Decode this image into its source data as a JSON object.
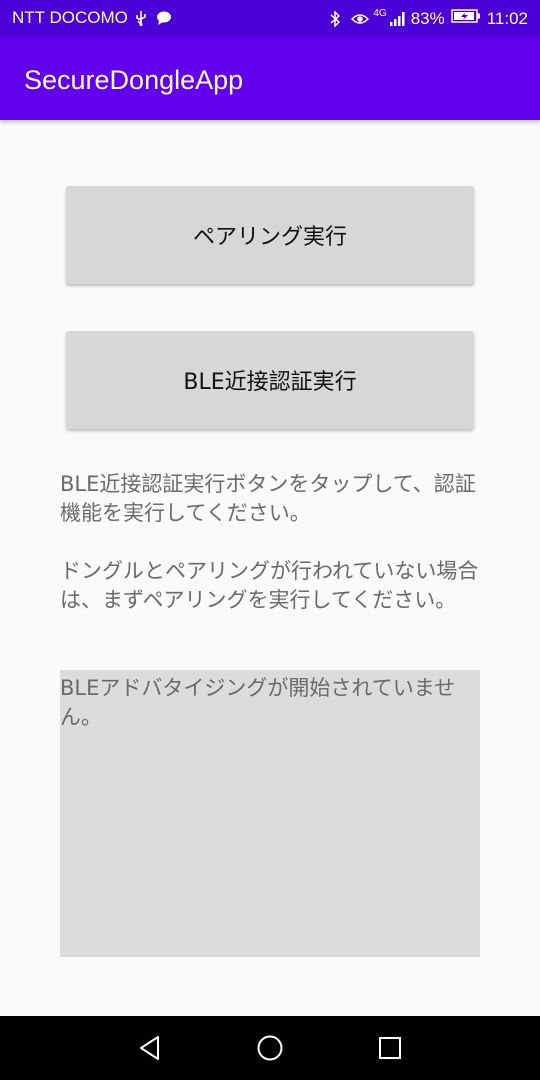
{
  "status_bar": {
    "carrier": "NTT DOCOMO",
    "network": "4G",
    "battery": "83%",
    "time": "11:02",
    "icons": [
      "usb-icon",
      "message-icon",
      "bluetooth-icon",
      "eye-icon",
      "signal-icon",
      "battery-icon"
    ]
  },
  "app_bar": {
    "title": "SecureDongleApp"
  },
  "buttons": {
    "pairing_label": "ペアリング実行",
    "ble_auth_label": "BLE近接認証実行"
  },
  "instructions": {
    "line1": "BLE近接認証実行ボタンをタップして、認証機能を実行してください。",
    "line2": "ドングルとペアリングが行われていない場合は、まずペアリングを実行してください。"
  },
  "status_box": {
    "text": "BLEアドバタイジングが開始されていません。"
  },
  "nav_bar": {
    "icons": [
      "back-icon",
      "home-icon",
      "recent-apps-icon"
    ]
  },
  "colors": {
    "status_bar": "#4a00d6",
    "app_bar": "#6200ee",
    "button": "#d6d7d7",
    "status_box": "#dcdcdc"
  }
}
